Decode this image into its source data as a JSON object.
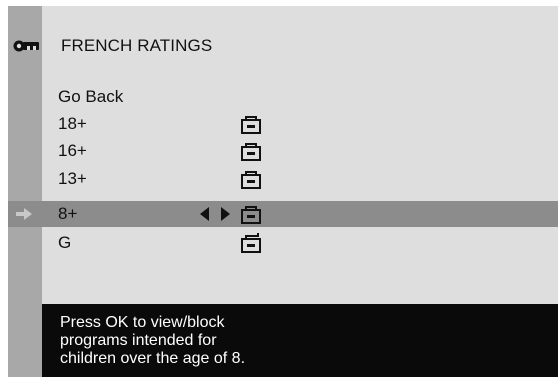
{
  "menu": {
    "title": "FRENCH RATINGS",
    "items": [
      {
        "label": "Go Back",
        "lock": "none"
      },
      {
        "label": "18+",
        "lock": "locked"
      },
      {
        "label": "16+",
        "lock": "locked"
      },
      {
        "label": "13+",
        "lock": "locked"
      },
      {
        "label": "8+",
        "lock": "locked",
        "selected": true
      },
      {
        "label": "G",
        "lock": "unlocked"
      }
    ]
  },
  "info": {
    "lines": [
      "Press OK to view/block",
      "programs intended for",
      "children over the age of 8."
    ]
  },
  "colors": {
    "background": "#dedede",
    "sidebar": "#a8a8a8",
    "selected_row": "#8c8c8c",
    "info_bar": "#0a0a0a"
  },
  "icons": {
    "header": "key-icon",
    "locked": "padlock-closed-icon",
    "unlocked": "padlock-open-icon",
    "selector": "right-arrow-icon",
    "adjust": "left-right-arrows-icon"
  }
}
